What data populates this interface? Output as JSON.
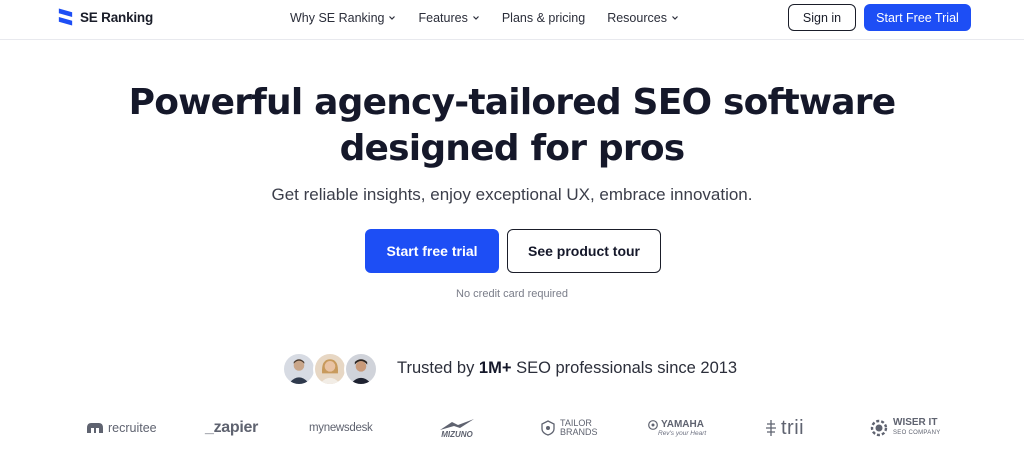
{
  "header": {
    "logo_text": "SE Ranking",
    "nav": [
      {
        "label": "Why SE Ranking",
        "has_dropdown": true
      },
      {
        "label": "Features",
        "has_dropdown": true
      },
      {
        "label": "Plans & pricing",
        "has_dropdown": false
      },
      {
        "label": "Resources",
        "has_dropdown": true
      }
    ],
    "signin_label": "Sign in",
    "trial_label": "Start Free Trial"
  },
  "hero": {
    "title_line1": "Powerful agency-tailored SEO software",
    "title_line2": "designed for pros",
    "subtitle": "Get reliable insights, enjoy exceptional UX, embrace innovation.",
    "primary_cta": "Start free trial",
    "secondary_cta": "See product tour",
    "note": "No credit card required"
  },
  "trust": {
    "prefix": "Trusted by ",
    "highlight": "1M+",
    "suffix": " SEO professionals since 2013"
  },
  "logos": [
    {
      "name": "recruitee"
    },
    {
      "name": "_zapier"
    },
    {
      "name": "mynewsdesk"
    },
    {
      "name": "MIZUNO"
    },
    {
      "name": "TAILOR BRANDS"
    },
    {
      "name": "YAMAHA",
      "sub": "Rev's your Heart"
    },
    {
      "name": "trii"
    },
    {
      "name": "WISER IT",
      "sub": "SEO COMPANY"
    }
  ],
  "colors": {
    "accent": "#1d4ef5",
    "text": "#15182a",
    "muted": "#7a7d89"
  }
}
